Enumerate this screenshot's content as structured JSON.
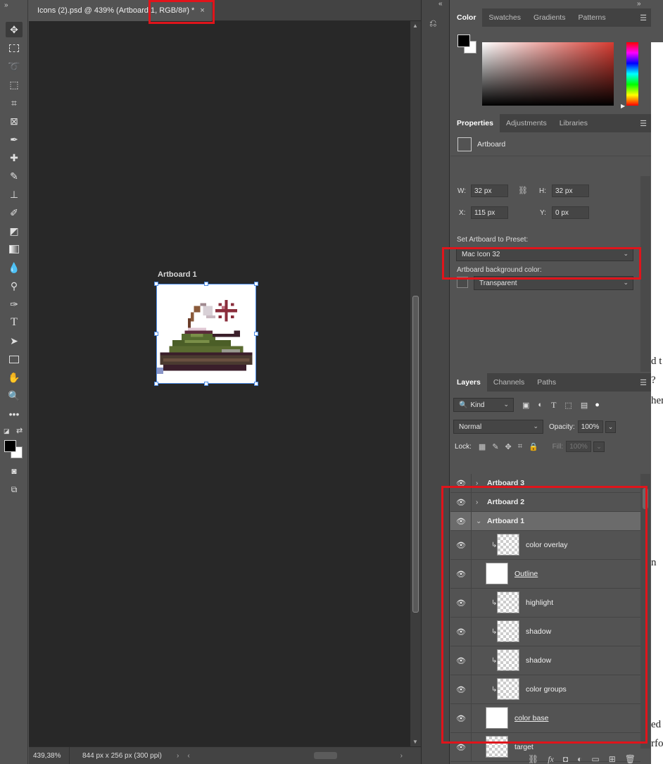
{
  "document": {
    "tab_title": "Icons (2).psd @ 439% (Artboard 1, RGB/8#) *",
    "close_glyph": "×",
    "artboard_label": "Artboard 1",
    "zoom": "439,38%",
    "doc_info": "844 px x 256 px (300 ppi)"
  },
  "toolbar": {
    "tools": [
      "move-tool",
      "rectangular-marquee-tool",
      "lasso-tool",
      "object-selection-tool",
      "crop-tool",
      "frame-tool",
      "eyedropper-tool",
      "spot-healing-tool",
      "brush-tool",
      "clone-stamp-tool",
      "history-brush-tool",
      "eraser-tool",
      "gradient-tool",
      "blur-tool",
      "dodge-tool",
      "pen-tool",
      "type-tool",
      "path-selection-tool",
      "rectangle-tool",
      "hand-tool",
      "zoom-tool",
      "more-tools",
      "quick-mask",
      "screen-mode"
    ],
    "foreground_color": "#000000",
    "background_color": "#ffffff"
  },
  "color_panel": {
    "tabs": [
      "Color",
      "Swatches",
      "Gradients",
      "Patterns"
    ],
    "active_tab": "Color"
  },
  "properties_panel": {
    "tabs": [
      "Properties",
      "Adjustments",
      "Libraries"
    ],
    "active_tab": "Properties",
    "object_type": "Artboard",
    "w_label": "W:",
    "w_value": "32 px",
    "h_label": "H:",
    "h_value": "32 px",
    "x_label": "X:",
    "x_value": "115 px",
    "y_label": "Y:",
    "y_value": "0 px",
    "preset_label": "Set Artboard to Preset:",
    "preset_value": "Mac Icon 32",
    "bg_label": "Artboard background color:",
    "bg_value": "Transparent"
  },
  "layers_panel": {
    "tabs": [
      "Layers",
      "Channels",
      "Paths"
    ],
    "active_tab": "Layers",
    "filter_kind": "Kind",
    "blend_mode": "Normal",
    "opacity_label": "Opacity:",
    "opacity_value": "100%",
    "lock_label": "Lock:",
    "fill_label": "Fill:",
    "fill_value": "100%",
    "layers": [
      {
        "name": "Artboard 3",
        "type": "artboard",
        "expanded": false
      },
      {
        "name": "Artboard 2",
        "type": "artboard",
        "expanded": false
      },
      {
        "name": "Artboard 1",
        "type": "artboard",
        "expanded": true,
        "selected": true
      },
      {
        "name": "color overlay",
        "type": "clipped"
      },
      {
        "name": "Outline",
        "type": "smart"
      },
      {
        "name": "highlight",
        "type": "clipped"
      },
      {
        "name": "shadow",
        "type": "clipped"
      },
      {
        "name": "shadow",
        "type": "clipped"
      },
      {
        "name": "color groups",
        "type": "clipped"
      },
      {
        "name": "color base",
        "type": "smart"
      },
      {
        "name": "target",
        "type": "normal"
      }
    ]
  },
  "highlight_color": "#e0141b",
  "side_text": [
    "d t",
    "?",
    "hen",
    "n",
    "ed",
    "rfo"
  ]
}
